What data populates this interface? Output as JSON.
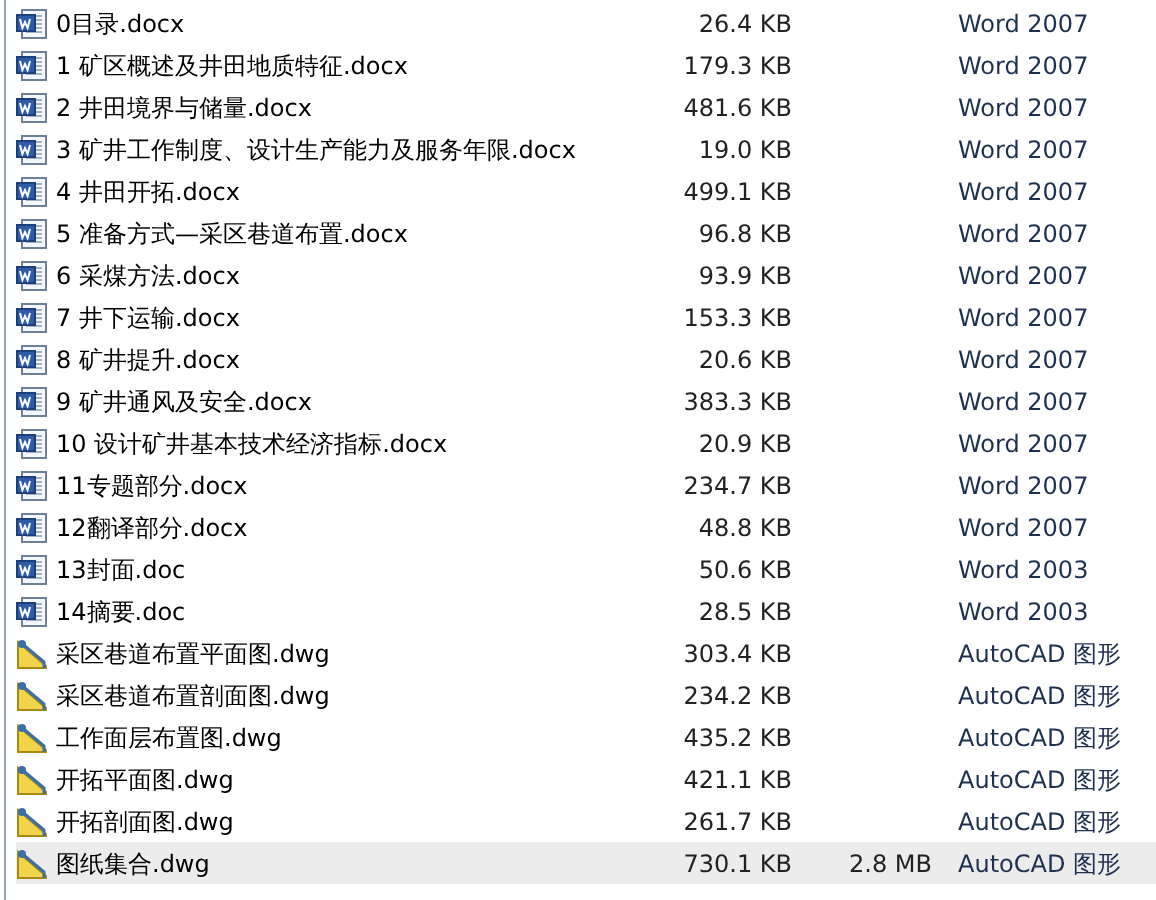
{
  "files": [
    {
      "name": "0目录.docx",
      "size": "26.4 KB",
      "type": "Word 2007",
      "kind": "word",
      "selected": false
    },
    {
      "name": "1 矿区概述及井田地质特征.docx",
      "size": "179.3 KB",
      "type": "Word 2007",
      "kind": "word",
      "selected": false
    },
    {
      "name": "2 井田境界与储量.docx",
      "size": "481.6 KB",
      "type": "Word 2007",
      "kind": "word",
      "selected": false
    },
    {
      "name": "3 矿井工作制度、设计生产能力及服务年限.docx",
      "size": "19.0 KB",
      "type": "Word 2007",
      "kind": "word",
      "selected": false
    },
    {
      "name": "4 井田开拓.docx",
      "size": "499.1 KB",
      "type": "Word 2007",
      "kind": "word",
      "selected": false
    },
    {
      "name": "5 准备方式—采区巷道布置.docx",
      "size": "96.8 KB",
      "type": "Word 2007",
      "kind": "word",
      "selected": false
    },
    {
      "name": "6 采煤方法.docx",
      "size": "93.9 KB",
      "type": "Word 2007",
      "kind": "word",
      "selected": false
    },
    {
      "name": "7 井下运输.docx",
      "size": "153.3 KB",
      "type": "Word 2007",
      "kind": "word",
      "selected": false
    },
    {
      "name": "8 矿井提升.docx",
      "size": "20.6 KB",
      "type": "Word 2007",
      "kind": "word",
      "selected": false
    },
    {
      "name": "9 矿井通风及安全.docx",
      "size": "383.3 KB",
      "type": "Word 2007",
      "kind": "word",
      "selected": false
    },
    {
      "name": "10 设计矿井基本技术经济指标.docx",
      "size": "20.9 KB",
      "type": "Word 2007",
      "kind": "word",
      "selected": false
    },
    {
      "name": "11专题部分.docx",
      "size": "234.7 KB",
      "type": "Word 2007",
      "kind": "word",
      "selected": false
    },
    {
      "name": "12翻译部分.docx",
      "size": "48.8 KB",
      "type": "Word 2007",
      "kind": "word",
      "selected": false
    },
    {
      "name": "13封面.doc",
      "size": "50.6 KB",
      "type": "Word 2003",
      "kind": "word",
      "selected": false
    },
    {
      "name": "14摘要.doc",
      "size": "28.5 KB",
      "type": "Word 2003",
      "kind": "word",
      "selected": false
    },
    {
      "name": "采区巷道布置平面图.dwg",
      "size": "303.4 KB",
      "type": "AutoCAD 图形",
      "kind": "dwg",
      "selected": false
    },
    {
      "name": "采区巷道布置剖面图.dwg",
      "size": "234.2 KB",
      "type": "AutoCAD 图形",
      "kind": "dwg",
      "selected": false
    },
    {
      "name": "工作面层布置图.dwg",
      "size": "435.2 KB",
      "type": "AutoCAD 图形",
      "kind": "dwg",
      "selected": false
    },
    {
      "name": "开拓平面图.dwg",
      "size": "421.1 KB",
      "type": "AutoCAD 图形",
      "kind": "dwg",
      "selected": false
    },
    {
      "name": "开拓剖面图.dwg",
      "size": "261.7 KB",
      "type": "AutoCAD 图形",
      "kind": "dwg",
      "selected": false
    },
    {
      "name": "图纸集合.dwg",
      "size": "730.1 KB",
      "column_3": "2.8 MB",
      "type": "AutoCAD 图形",
      "kind": "dwg",
      "selected": true
    }
  ]
}
